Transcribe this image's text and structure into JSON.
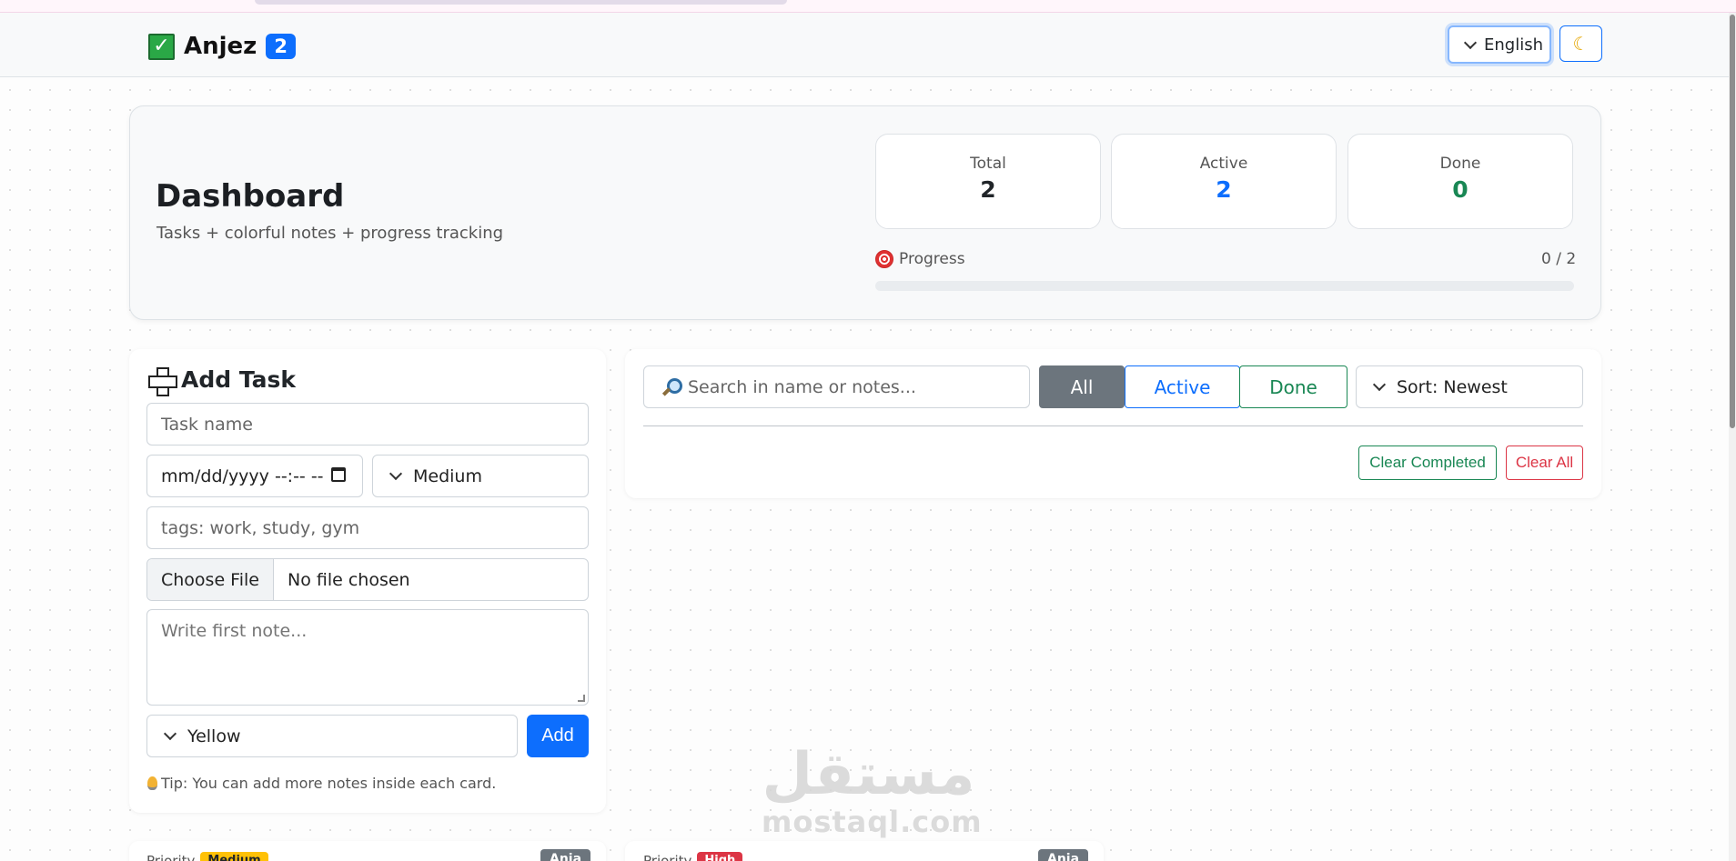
{
  "navbar": {
    "brand": "Anjez",
    "badge_count": "2",
    "language": "English",
    "theme_icon": "moon-icon"
  },
  "dashboard": {
    "title": "Dashboard",
    "subtitle": "Tasks + colorful notes + progress tracking",
    "stats": {
      "total_label": "Total",
      "total_value": "2",
      "active_label": "Active",
      "active_value": "2",
      "done_label": "Done",
      "done_value": "0"
    },
    "progress_label": "Progress",
    "progress_count": "0 / 2",
    "progress_fraction": 0
  },
  "add_task": {
    "title": "Add Task",
    "task_name_placeholder": "Task name",
    "datetime_placeholder": "mm/dd/yyyy --:-- --",
    "priority": "Medium",
    "tags_placeholder": "tags: work, study, gym",
    "file_button": "Choose File",
    "file_status": "No file chosen",
    "note_placeholder": "Write first note...",
    "note_color": "Yellow",
    "add_button": "Add",
    "tip": "Tip: You can add more notes inside each card."
  },
  "filters": {
    "search_placeholder": "Search in name or notes...",
    "all": "All",
    "active": "Active",
    "done": "Done",
    "sort": "Sort: Newest",
    "clear_completed": "Clear Completed",
    "clear_all": "Clear All"
  },
  "tasks": [
    {
      "priority_label": "Priority",
      "priority": "Medium",
      "tag": "Anja"
    },
    {
      "priority_label": "Priority",
      "priority": "High",
      "tag": "Anja"
    }
  ],
  "watermark": {
    "arabic": "مستقل",
    "latin": "mostaql.com"
  },
  "colors": {
    "primary": "#0d6efd",
    "success": "#198754",
    "danger": "#dc3545",
    "secondary": "#6c757d",
    "warning": "#ffc107"
  }
}
